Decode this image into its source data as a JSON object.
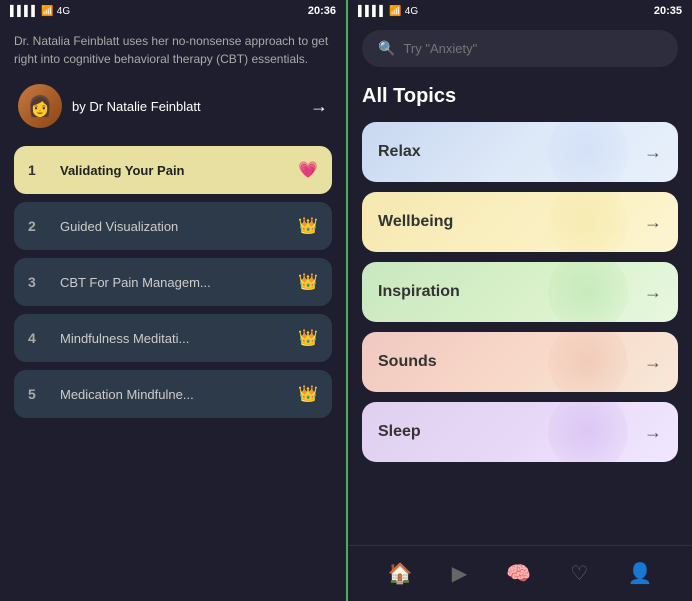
{
  "left": {
    "status_bar": {
      "signal": "4G",
      "time": "20:36"
    },
    "description": "Dr. Natalia Feinblatt uses her no-nonsense approach to get right into cognitive behavioral therapy (CBT) essentials.",
    "author": {
      "name": "by Dr Natalie Feinblatt",
      "avatar_emoji": "👩"
    },
    "tracks": [
      {
        "number": "1",
        "title": "Validating Your Pain",
        "icon": "💗",
        "active": true
      },
      {
        "number": "2",
        "title": "Guided Visualization",
        "icon": "👑",
        "active": false
      },
      {
        "number": "3",
        "title": "CBT For Pain Managem...",
        "icon": "👑",
        "active": false
      },
      {
        "number": "4",
        "title": "Mindfulness Meditati...",
        "icon": "👑",
        "active": false
      },
      {
        "number": "5",
        "title": "Medication Mindfulne...",
        "icon": "👑",
        "active": false
      }
    ]
  },
  "right": {
    "status_bar": {
      "signal": "4G",
      "time": "20:35"
    },
    "search": {
      "placeholder": "Try \"Anxiety\""
    },
    "all_topics_label": "All Topics",
    "topics": [
      {
        "label": "Relax",
        "style": "relax"
      },
      {
        "label": "Wellbeing",
        "style": "wellbeing"
      },
      {
        "label": "Inspiration",
        "style": "inspiration"
      },
      {
        "label": "Sounds",
        "style": "sounds"
      },
      {
        "label": "Sleep",
        "style": "sleep"
      }
    ],
    "nav": [
      {
        "icon": "🏠",
        "label": "Home",
        "active": false
      },
      {
        "icon": "▶",
        "label": "Play",
        "active": false
      },
      {
        "icon": "🧠",
        "label": "Mindfulness",
        "active": true
      },
      {
        "icon": "♡",
        "label": "Favorites",
        "active": false
      },
      {
        "icon": "👤",
        "label": "Profile",
        "active": false
      }
    ]
  }
}
